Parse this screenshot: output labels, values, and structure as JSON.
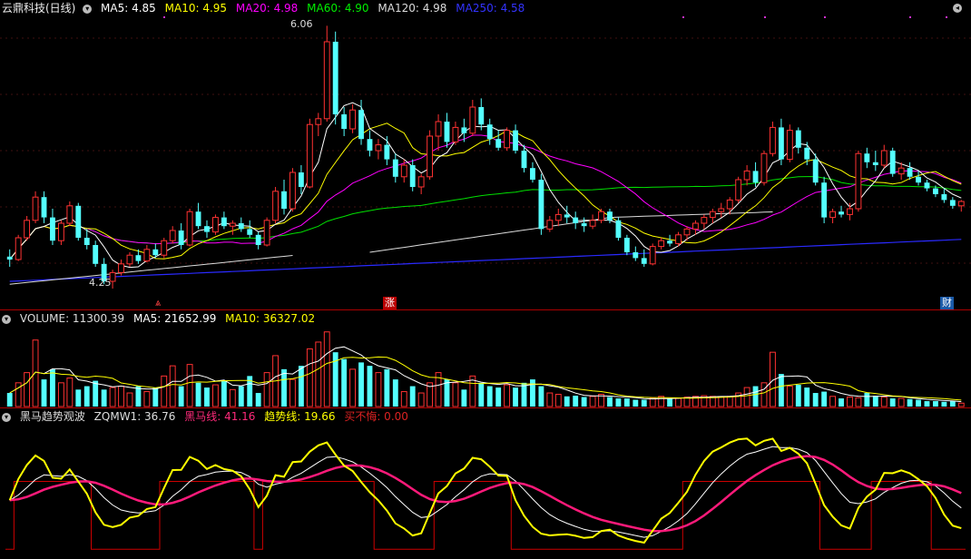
{
  "main_header": {
    "stock_title": "云鼎科技(日线)",
    "ma5": "MA5: 4.85",
    "ma10": "MA10: 4.95",
    "ma20": "MA20: 4.98",
    "ma60": "MA60: 4.90",
    "ma120": "MA120: 4.98",
    "ma250": "MA250: 4.58"
  },
  "price_labels": {
    "high": "6.06",
    "low": "4.25"
  },
  "markers": {
    "limit_up": "涨",
    "finance": "财",
    "up_arrow": "⩓"
  },
  "volume_header": {
    "volume": "VOLUME: 11300.39",
    "ma5": "MA5: 21652.99",
    "ma10": "MA10: 36327.02"
  },
  "indicator_header": {
    "name": "黑马趋势观波",
    "zqmw1": "ZQMW1: 36.76",
    "heima": "黑马线: 41.16",
    "trend": "趋势线: 19.66",
    "buysell": "买不悔: 0.00"
  },
  "colors": {
    "up": "#ff3232",
    "down": "#54ffff",
    "ma5": "#ffffff",
    "ma10": "#ffff00",
    "ma20": "#ff00ff",
    "ma60": "#00e000",
    "ma120": "#dddddd",
    "ma250": "#2a2aff",
    "heima": "#ff1a7a",
    "trend": "#ffff00",
    "buysell": "#cc0000",
    "sep": "#a00000"
  },
  "icons": {
    "collapse": "circle-chevron-down-icon",
    "scroll": "circle-arrow-icon"
  },
  "chart_data": [
    {
      "type": "candlestick",
      "x_count": 112,
      "ylim": [
        4.2,
        6.1
      ],
      "ohlc": [
        [
          4.47,
          4.52,
          4.4,
          4.45
        ],
        [
          4.45,
          4.62,
          4.44,
          4.6
        ],
        [
          4.6,
          4.75,
          4.58,
          4.72
        ],
        [
          4.72,
          4.92,
          4.7,
          4.88
        ],
        [
          4.88,
          4.92,
          4.7,
          4.74
        ],
        [
          4.74,
          4.8,
          4.55,
          4.58
        ],
        [
          4.58,
          4.72,
          4.55,
          4.7
        ],
        [
          4.7,
          4.85,
          4.68,
          4.82
        ],
        [
          4.82,
          4.84,
          4.58,
          4.6
        ],
        [
          4.6,
          4.66,
          4.52,
          4.55
        ],
        [
          4.55,
          4.58,
          4.4,
          4.42
        ],
        [
          4.42,
          4.46,
          4.28,
          4.3
        ],
        [
          4.3,
          4.38,
          4.25,
          4.36
        ],
        [
          4.36,
          4.45,
          4.34,
          4.42
        ],
        [
          4.42,
          4.5,
          4.4,
          4.48
        ],
        [
          4.48,
          4.52,
          4.42,
          4.44
        ],
        [
          4.44,
          4.55,
          4.43,
          4.52
        ],
        [
          4.52,
          4.56,
          4.46,
          4.48
        ],
        [
          4.48,
          4.6,
          4.46,
          4.58
        ],
        [
          4.58,
          4.68,
          4.56,
          4.65
        ],
        [
          4.65,
          4.7,
          4.52,
          4.55
        ],
        [
          4.55,
          4.8,
          4.54,
          4.78
        ],
        [
          4.78,
          4.84,
          4.66,
          4.68
        ],
        [
          4.68,
          4.72,
          4.6,
          4.64
        ],
        [
          4.64,
          4.76,
          4.62,
          4.74
        ],
        [
          4.74,
          4.78,
          4.66,
          4.68
        ],
        [
          4.68,
          4.72,
          4.62,
          4.7
        ],
        [
          4.7,
          4.74,
          4.64,
          4.66
        ],
        [
          4.66,
          4.72,
          4.6,
          4.62
        ],
        [
          4.62,
          4.64,
          4.52,
          4.55
        ],
        [
          4.55,
          4.74,
          4.54,
          4.72
        ],
        [
          4.72,
          4.95,
          4.7,
          4.92
        ],
        [
          4.92,
          5.0,
          4.76,
          4.8
        ],
        [
          4.8,
          5.08,
          4.78,
          5.05
        ],
        [
          5.05,
          5.1,
          4.9,
          4.95
        ],
        [
          4.95,
          5.42,
          4.94,
          5.38
        ],
        [
          5.38,
          5.46,
          5.3,
          5.42
        ],
        [
          5.42,
          6.06,
          5.4,
          5.95
        ],
        [
          5.95,
          6.02,
          5.38,
          5.45
        ],
        [
          5.45,
          5.5,
          5.3,
          5.35
        ],
        [
          5.35,
          5.52,
          5.32,
          5.48
        ],
        [
          5.48,
          5.55,
          5.24,
          5.28
        ],
        [
          5.28,
          5.34,
          5.16,
          5.2
        ],
        [
          5.2,
          5.28,
          5.14,
          5.24
        ],
        [
          5.24,
          5.3,
          5.1,
          5.14
        ],
        [
          5.14,
          5.18,
          4.98,
          5.02
        ],
        [
          5.02,
          5.14,
          4.98,
          5.1
        ],
        [
          5.1,
          5.14,
          4.92,
          4.95
        ],
        [
          4.95,
          5.04,
          4.9,
          5.02
        ],
        [
          5.02,
          5.34,
          5.0,
          5.3
        ],
        [
          5.3,
          5.45,
          5.2,
          5.4
        ],
        [
          5.4,
          5.46,
          5.22,
          5.26
        ],
        [
          5.26,
          5.4,
          5.24,
          5.36
        ],
        [
          5.36,
          5.42,
          5.26,
          5.32
        ],
        [
          5.32,
          5.55,
          5.3,
          5.5
        ],
        [
          5.5,
          5.56,
          5.34,
          5.38
        ],
        [
          5.38,
          5.42,
          5.24,
          5.28
        ],
        [
          5.28,
          5.34,
          5.2,
          5.22
        ],
        [
          5.22,
          5.36,
          5.2,
          5.34
        ],
        [
          5.34,
          5.38,
          5.18,
          5.2
        ],
        [
          5.2,
          5.24,
          5.05,
          5.08
        ],
        [
          5.08,
          5.12,
          4.98,
          5.0
        ],
        [
          5.0,
          5.04,
          4.62,
          4.66
        ],
        [
          4.66,
          4.75,
          4.64,
          4.72
        ],
        [
          4.72,
          4.8,
          4.68,
          4.76
        ],
        [
          4.76,
          4.82,
          4.7,
          4.74
        ],
        [
          4.74,
          4.78,
          4.66,
          4.7
        ],
        [
          4.7,
          4.74,
          4.64,
          4.68
        ],
        [
          4.68,
          4.76,
          4.66,
          4.72
        ],
        [
          4.72,
          4.8,
          4.7,
          4.78
        ],
        [
          4.78,
          4.8,
          4.7,
          4.72
        ],
        [
          4.72,
          4.74,
          4.58,
          4.6
        ],
        [
          4.6,
          4.62,
          4.48,
          4.5
        ],
        [
          4.5,
          4.54,
          4.44,
          4.46
        ],
        [
          4.46,
          4.52,
          4.4,
          4.42
        ],
        [
          4.42,
          4.56,
          4.41,
          4.54
        ],
        [
          4.54,
          4.6,
          4.52,
          4.58
        ],
        [
          4.58,
          4.62,
          4.54,
          4.56
        ],
        [
          4.56,
          4.64,
          4.54,
          4.62
        ],
        [
          4.62,
          4.68,
          4.58,
          4.66
        ],
        [
          4.66,
          4.72,
          4.62,
          4.7
        ],
        [
          4.7,
          4.76,
          4.66,
          4.74
        ],
        [
          4.74,
          4.8,
          4.7,
          4.78
        ],
        [
          4.78,
          4.84,
          4.74,
          4.8
        ],
        [
          4.8,
          4.88,
          4.76,
          4.86
        ],
        [
          4.86,
          5.02,
          4.84,
          5.0
        ],
        [
          5.0,
          5.1,
          4.96,
          5.06
        ],
        [
          5.06,
          5.12,
          4.95,
          4.98
        ],
        [
          4.98,
          5.2,
          4.96,
          5.18
        ],
        [
          5.18,
          5.4,
          5.16,
          5.36
        ],
        [
          5.36,
          5.42,
          5.1,
          5.14
        ],
        [
          5.14,
          5.38,
          5.12,
          5.34
        ],
        [
          5.34,
          5.36,
          5.18,
          5.22
        ],
        [
          5.22,
          5.26,
          5.1,
          5.14
        ],
        [
          5.14,
          5.18,
          4.96,
          4.98
        ],
        [
          4.98,
          5.02,
          4.7,
          4.74
        ],
        [
          4.74,
          4.8,
          4.7,
          4.78
        ],
        [
          4.78,
          4.82,
          4.74,
          4.76
        ],
        [
          4.76,
          4.84,
          4.72,
          4.8
        ],
        [
          4.8,
          5.2,
          4.78,
          5.18
        ],
        [
          5.18,
          5.22,
          5.08,
          5.12
        ],
        [
          5.12,
          5.2,
          5.06,
          5.1
        ],
        [
          5.1,
          5.24,
          5.08,
          5.2
        ],
        [
          5.2,
          5.22,
          5.02,
          5.04
        ],
        [
          5.04,
          5.12,
          5.0,
          5.08
        ],
        [
          5.08,
          5.12,
          5.0,
          5.02
        ],
        [
          5.02,
          5.06,
          4.96,
          4.98
        ],
        [
          4.98,
          5.0,
          4.92,
          4.94
        ],
        [
          4.94,
          4.96,
          4.88,
          4.9
        ],
        [
          4.9,
          4.94,
          4.84,
          4.86
        ],
        [
          4.86,
          4.88,
          4.8,
          4.82
        ],
        [
          4.82,
          4.86,
          4.78,
          4.85
        ]
      ]
    },
    {
      "type": "bar",
      "volumes": [
        20,
        35,
        50,
        98,
        40,
        55,
        35,
        42,
        25,
        30,
        38,
        25,
        28,
        30,
        20,
        30,
        22,
        28,
        45,
        60,
        30,
        62,
        35,
        28,
        32,
        38,
        25,
        30,
        45,
        20,
        50,
        75,
        55,
        40,
        60,
        85,
        95,
        110,
        80,
        70,
        55,
        65,
        60,
        50,
        55,
        40,
        22,
        30,
        20,
        35,
        50,
        40,
        35,
        25,
        45,
        35,
        30,
        28,
        32,
        28,
        35,
        40,
        30,
        20,
        18,
        15,
        16,
        14,
        15,
        18,
        14,
        12,
        12,
        10,
        10,
        12,
        15,
        12,
        12,
        14,
        15,
        16,
        15,
        14,
        15,
        20,
        28,
        30,
        35,
        80,
        48,
        30,
        32,
        28,
        20,
        22,
        15,
        12,
        14,
        13,
        20,
        16,
        14,
        12,
        12,
        11,
        10,
        8,
        8,
        7,
        8,
        5
      ]
    }
  ]
}
